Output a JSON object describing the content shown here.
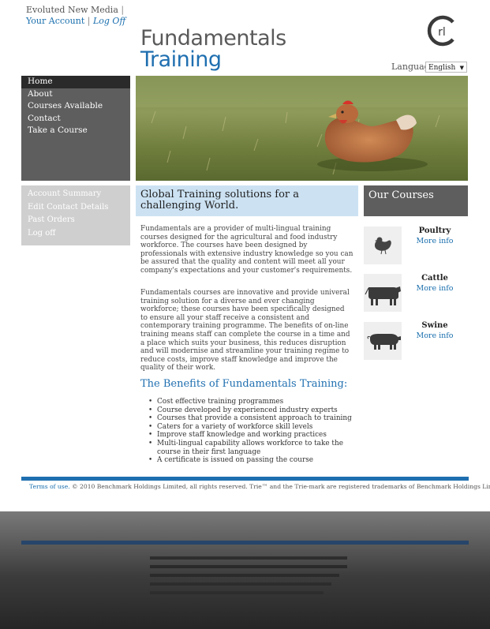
{
  "header": {
    "company": "Evoluted New Media",
    "separator": "|",
    "your_account": "Your Account",
    "log_off": "Log Off",
    "brand_line1": "Fundamentals",
    "brand_line2": "Training",
    "brand_mark_text": "rl",
    "language_label": "Language",
    "language_value": "English"
  },
  "nav": {
    "items": [
      {
        "label": "Home"
      },
      {
        "label": "About"
      },
      {
        "label": "Courses Available"
      },
      {
        "label": "Contact"
      },
      {
        "label": "Take a Course"
      }
    ]
  },
  "account_menu": {
    "items": [
      {
        "label": "Account Summary"
      },
      {
        "label": "Edit Contact Details"
      },
      {
        "label": "Past Orders"
      },
      {
        "label": "Log off"
      }
    ]
  },
  "main": {
    "heading": "Global Training solutions for a challenging World.",
    "paragraph1": "Fundamentals are a provider of multi-lingual training courses designed for the agricultural and food industry workforce. The courses have been designed by professionals with extensive industry knowledge so you can be assured that the quality and content will meet all your company's expectations and your customer's requirements.",
    "paragraph2": "Fundamentals courses are innovative and provide univeral training solution for a diverse and ever changing workforce; these courses have been specifically designed to ensure all your staff receive a consistent and contemporary training programme. The benefits of on-line training means staff can complete the course in a time and a place which suits your business, this reduces disruption and will modernise and streamline your training regime to reduce costs, improve staff knowledge and improve the quality of their work.",
    "benefits_title": "The Benefits of Fundamentals Training:",
    "benefits": [
      "Cost effective training programmes",
      "Course developed by experienced industry experts",
      "Courses that provide a consistent approach to training",
      "Caters for a variety of workforce skill levels",
      "Improve staff knowledge and working practices",
      "Multi-lingual capability allows workforce to take the course in their first language",
      "A certificate is issued on passing the course"
    ]
  },
  "courses": {
    "title": "Our Courses",
    "items": [
      {
        "name": "Poultry",
        "more": "More info",
        "icon": "chicken-icon"
      },
      {
        "name": "Cattle",
        "more": "More info",
        "icon": "cow-icon"
      },
      {
        "name": "Swine",
        "more": "More info",
        "icon": "pig-icon"
      }
    ]
  },
  "footer": {
    "terms": "Terms of use.",
    "copyright": " © 2010 Benchmark Holdings Limited, all rights reserved. Trie™ and the Trie-mark are registered trademarks of Benchmark Holdings Limited."
  },
  "colors": {
    "accent": "#1f6fb0",
    "nav_bg": "#5e5e5e",
    "nav_active": "#2a2a2a",
    "welcome_bg": "#cce2f3",
    "account_bg": "#cfcfcf"
  }
}
